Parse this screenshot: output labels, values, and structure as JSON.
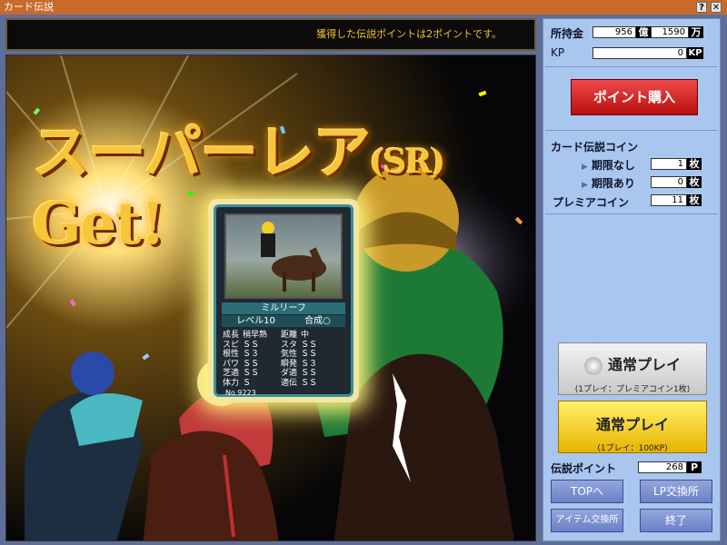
{
  "window": {
    "title": "カード伝説"
  },
  "message": "獲得した伝説ポイントは2ポイントです。",
  "headline": {
    "main": "スーパーレア",
    "sr": "(SR)",
    "get": "Get!"
  },
  "card": {
    "name": "ミルリーフ",
    "level": "レベル10",
    "fusion": "合成○",
    "stats": [
      [
        "成長",
        "稍早熟",
        "距離",
        "中"
      ],
      [
        "スピ",
        "ＳＳ",
        "スタ",
        "ＳＳ"
      ],
      [
        "根性",
        "Ｓ３",
        "気性",
        "ＳＳ"
      ],
      [
        "パワ",
        "ＳＳ",
        "瞬発",
        "Ｓ３"
      ],
      [
        "芝適",
        "ＳＳ",
        "ダ適",
        "ＳＳ"
      ],
      [
        "体力",
        "Ｓ",
        "適伝",
        "ＳＳ"
      ]
    ],
    "number": "No.9223"
  },
  "side": {
    "money_label": "所持金",
    "money_oku": "956",
    "oku": "億",
    "money_man": "1590",
    "man": "万",
    "kp_label": "KP",
    "kp": "0",
    "kp_unit": "KP",
    "buy_label": "ポイント購入",
    "coin_title": "カード伝説コイン",
    "no_limit_label": "期限なし",
    "no_limit": "1",
    "mai": "枚",
    "limit_label": "期限あり",
    "limit": "0",
    "premium_label": "プレミアコイン",
    "premium": "11",
    "play_premium": {
      "label": "通常プレイ",
      "note": "(1プレイ：プレミアコイン1枚)"
    },
    "play_kp": {
      "label": "通常プレイ",
      "note": "(1プレイ：100KP)"
    },
    "legend_label": "伝説ポイント",
    "legend": "268",
    "p": "P",
    "top": "TOPへ",
    "lp": "LP交換所",
    "item": "アイテム交換所",
    "exit": "終了"
  }
}
